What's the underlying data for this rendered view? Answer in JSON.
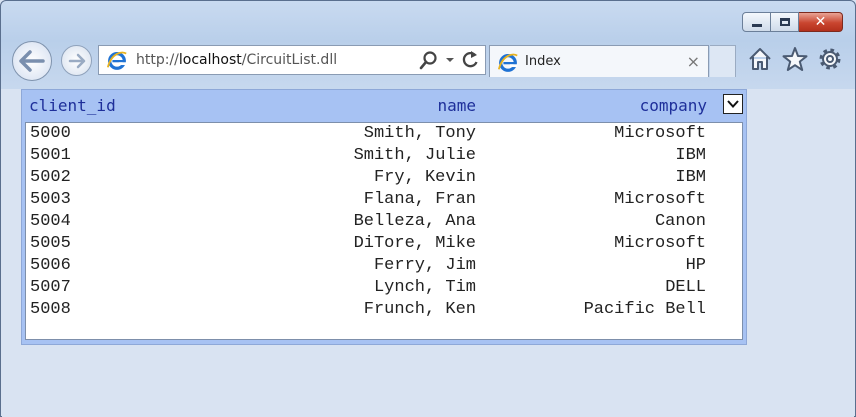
{
  "browser": {
    "url_prefix": "http://",
    "url_host": "localhost",
    "url_path": "/CircuitList.dll",
    "tab_title": "Index",
    "tab_close": "×",
    "close_glyph": "✕"
  },
  "grid": {
    "columns": [
      "client_id",
      "name",
      "company"
    ],
    "rows": [
      {
        "client_id": "5000",
        "name": "Smith, Tony",
        "company": "Microsoft"
      },
      {
        "client_id": "5001",
        "name": "Smith, Julie",
        "company": "IBM"
      },
      {
        "client_id": "5002",
        "name": "Fry, Kevin",
        "company": "IBM"
      },
      {
        "client_id": "5003",
        "name": "Flana, Fran",
        "company": "Microsoft"
      },
      {
        "client_id": "5004",
        "name": "Belleza, Ana",
        "company": "Canon"
      },
      {
        "client_id": "5005",
        "name": "DiTore, Mike",
        "company": "Microsoft"
      },
      {
        "client_id": "5006",
        "name": "Ferry, Jim",
        "company": "HP"
      },
      {
        "client_id": "5007",
        "name": "Lynch, Tim",
        "company": "DELL"
      },
      {
        "client_id": "5008",
        "name": "Frunch, Ken",
        "company": "Pacific Bell"
      }
    ]
  },
  "colors": {
    "header_bg": "#a7c2f3",
    "header_text": "#1e2f9a",
    "ie_blue": "#1f72d4",
    "ie_gold": "#e8b320"
  }
}
